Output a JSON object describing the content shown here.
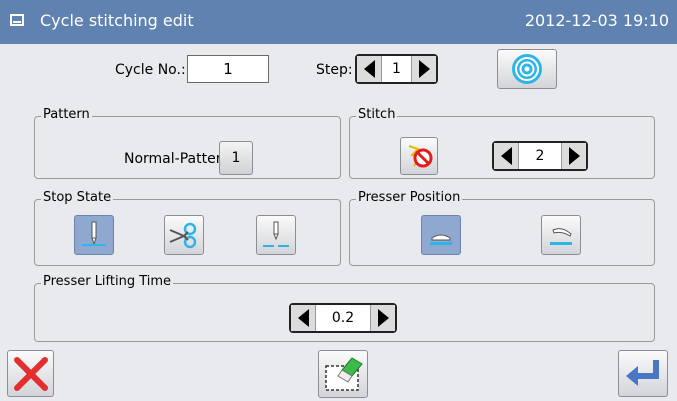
{
  "titlebar": {
    "title": "Cycle stitching edit",
    "datetime": "2012-12-03 19:10",
    "icon": "window-icon"
  },
  "cycle": {
    "label": "Cycle No.:",
    "value": "1"
  },
  "step": {
    "label": "Step:",
    "value": "1"
  },
  "pattern": {
    "group_title": "Pattern",
    "label": "Normal-Pattern:",
    "value": "1"
  },
  "stitch": {
    "group_title": "Stitch",
    "value": "2",
    "icon": "no-stitch-icon"
  },
  "stop_state": {
    "group_title": "Stop State",
    "options": [
      "needle-down-icon",
      "thread-trim-icon",
      "needle-up-icon"
    ],
    "selected": 0
  },
  "presser_position": {
    "group_title": "Presser Position",
    "options": [
      "presser-down-icon",
      "presser-up-icon"
    ],
    "selected": 0
  },
  "presser_lifting_time": {
    "group_title": "Presser Lifting Time",
    "value": "0.2"
  },
  "bottom": {
    "cancel_icon": "close-icon",
    "erase_icon": "eraser-icon",
    "confirm_icon": "enter-icon"
  },
  "colors": {
    "titlebar": "#5f82b1",
    "accent_cyan": "#2eb5e8",
    "cancel_red": "#e12f2f",
    "enter_blue": "#4a77c4",
    "selected": "#8ea8cf"
  }
}
